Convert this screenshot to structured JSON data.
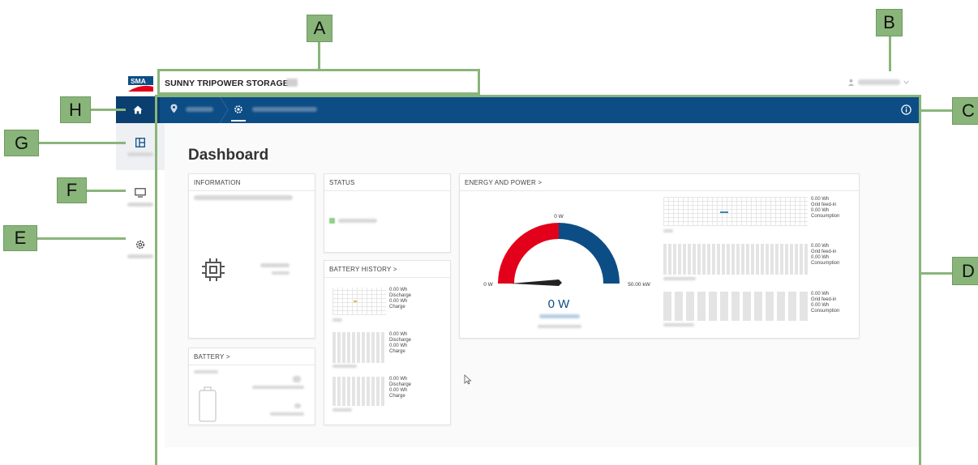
{
  "header": {
    "logo_text": "SMA",
    "title": "SUNNY TRIPOWER STORAGE"
  },
  "nav": {
    "home_icon": "home-icon",
    "location_icon": "location-pin-icon",
    "device_icon": "gear-icon",
    "info_icon": "info-icon"
  },
  "sidebar": {
    "items": [
      {
        "icon": "dashboard-icon"
      },
      {
        "icon": "monitor-icon"
      },
      {
        "icon": "settings-icon"
      }
    ]
  },
  "main": {
    "title": "Dashboard",
    "information": {
      "header": "INFORMATION"
    },
    "status": {
      "header": "STATUS"
    },
    "battery_history": {
      "header": "BATTERY HISTORY",
      "chevron": ">",
      "blocks": [
        {
          "v1": "0.00 Wh",
          "l1": "Discharge",
          "v2": "0.00 Wh",
          "l2": "Charge"
        },
        {
          "v1": "0.00 Wh",
          "l1": "Discharge",
          "v2": "0.00 Wh",
          "l2": "Charge"
        },
        {
          "v1": "0.00 Wh",
          "l1": "Discharge",
          "v2": "0.00 Wh",
          "l2": "Charge"
        }
      ]
    },
    "battery": {
      "header": "BATTERY",
      "chevron": ">"
    },
    "energy": {
      "header": "ENERGY AND POWER",
      "chevron": ">",
      "gauge_top": "0 W",
      "gauge_min": "0 W",
      "gauge_max": "50.00 kW",
      "gauge_value": "0 W",
      "gauge_level": 0,
      "blocks": [
        {
          "v1": "0.00 Wh",
          "l1": "Grid feed-in",
          "v2": "0.00 Wh",
          "l2": "Consumption"
        },
        {
          "v1": "0.00 Wh",
          "l1": "Grid feed-in",
          "v2": "0.00 Wh",
          "l2": "Consumption"
        },
        {
          "v1": "0.00 Wh",
          "l1": "Grid feed-in",
          "v2": "0.00 Wh",
          "l2": "Consumption"
        }
      ]
    }
  },
  "annotations": {
    "a": "A",
    "b": "B",
    "c": "C",
    "d": "D",
    "e": "E",
    "f": "F",
    "g": "G",
    "h": "H"
  },
  "colors": {
    "navbar": "#0d4d85",
    "gauge_red": "#e2001a",
    "gauge_blue": "#0d4d85",
    "annotation": "#8ab57a"
  }
}
